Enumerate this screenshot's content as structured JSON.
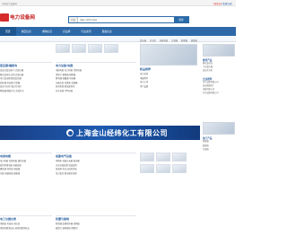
{
  "topbar": {
    "left": "中国电力设备网",
    "right_red": "[请登录]",
    "right_blue": "[免费注册]"
  },
  "logo": {
    "text": "电力设备网"
  },
  "search": {
    "select": "产品",
    "placeholder": "请输入搜索关键词",
    "button": "搜索"
  },
  "nav": [
    {
      "label": "首页"
    },
    {
      "label": "供应信息"
    },
    {
      "label": "求购信息"
    },
    {
      "label": "企业库"
    },
    {
      "label": "行业资讯"
    },
    {
      "label": "展会信息"
    }
  ],
  "subbar": {
    "links": [
      "变压器",
      "开关柜",
      "电线电缆",
      "互感器",
      "断路器",
      "避雷器"
    ]
  },
  "col1": {
    "title": "变压器/输配电",
    "lines": [
      "油浸式变压器 干式变压器",
      "箱式变电站 组合式变压器",
      "电力变压器 整流变压器",
      "调压器 电抗器 互感器",
      "高压开关柜 低压开关柜",
      "断路器 隔离开关 负荷开关"
    ]
  },
  "col2": {
    "title": "电力设备/电器",
    "lines": [
      "电线电缆 电力电缆 控制电缆",
      "绝缘子 避雷器 熔断器",
      "继电器 接触器 电容器",
      "仪器仪表 电能表 变频器",
      "发电机组 柴油发电机",
      "开关电源 UPS电源"
    ]
  },
  "col3": {
    "title": "新品推荐",
    "lines": [
      "电力金具",
      "电缆附件",
      "电力工具",
      "电气设备"
    ]
  },
  "banner": {
    "text": "上海金山经纬化工有限公司"
  },
  "col1b": {
    "title": "电线电缆",
    "lines": [
      "电力电缆 控制电缆 通信电缆",
      "架空绝缘电缆 电缆桥架",
      "裸电线 漆包线 电磁线",
      "光缆 同轴电缆 屏蔽线"
    ]
  },
  "col2b": {
    "title": "成套电气设备",
    "lines": [
      "环网柜 电缆分支箱 配电箱",
      "无功补偿装置 滤波装置",
      "直流屏 电力自动化系统",
      "电力监控 继电保护装置"
    ]
  },
  "col1c": {
    "title": "电工仪器仪表",
    "lines": [
      "电能表 电流表 电压表",
      "绝缘电阻测试仪 接地电阻测试仪"
    ]
  },
  "col2c": {
    "title": "防雷与接地",
    "lines": [
      "防雷器 浪涌保护器 接地极",
      "避雷针 接地模块 降阻剂"
    ]
  },
  "sidebar": {
    "title1": "推荐产品",
    "lines1": [
      "箱式变电站",
      "干式变压器",
      "高压开关柜"
    ],
    "title2": "企业推荐",
    "lines2": [
      "电气设备有限公司",
      "变压器制造厂",
      "电缆有限公司",
      "开关设备有限公司"
    ],
    "title3": "热门产品",
    "lines3": [
      "断路器",
      "避雷器",
      "互感器"
    ]
  }
}
